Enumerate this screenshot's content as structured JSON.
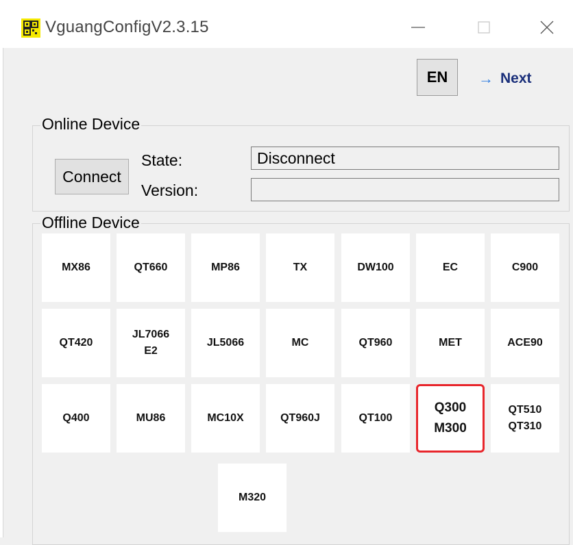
{
  "window": {
    "title": "VguangConfigV2.3.15"
  },
  "toolbar": {
    "language_label": "EN",
    "next_arrow": "→",
    "next_label": "Next"
  },
  "online_device": {
    "group_label": "Online Device",
    "connect_label": "Connect",
    "state_label": "State:",
    "state_value": "Disconnect",
    "version_label": "Version:",
    "version_value": ""
  },
  "offline_device": {
    "group_label": "Offline Device",
    "devices": [
      {
        "lines": [
          "MX86"
        ]
      },
      {
        "lines": [
          "QT660"
        ]
      },
      {
        "lines": [
          "MP86"
        ]
      },
      {
        "lines": [
          "TX"
        ]
      },
      {
        "lines": [
          "DW100"
        ]
      },
      {
        "lines": [
          "EC"
        ]
      },
      {
        "lines": [
          "C900"
        ]
      },
      {
        "lines": [
          "QT420"
        ]
      },
      {
        "lines": [
          "JL7066",
          "E2"
        ]
      },
      {
        "lines": [
          "JL5066"
        ]
      },
      {
        "lines": [
          "MC"
        ]
      },
      {
        "lines": [
          "QT960"
        ]
      },
      {
        "lines": [
          "MET"
        ]
      },
      {
        "lines": [
          "ACE90"
        ]
      },
      {
        "lines": [
          "Q400"
        ]
      },
      {
        "lines": [
          "MU86"
        ]
      },
      {
        "lines": [
          "MC10X"
        ]
      },
      {
        "lines": [
          "QT960J"
        ]
      },
      {
        "lines": [
          "QT100"
        ]
      },
      {
        "lines": [
          "Q300",
          "M300"
        ],
        "highlighted": true,
        "highlight_color": "#e8262c"
      },
      {
        "lines": [
          "QT510",
          "QT310"
        ]
      },
      {
        "lines": [
          "M320"
        ]
      }
    ]
  },
  "icons": {
    "app": "qr-code-icon",
    "minimize": "minimize-icon",
    "maximize": "maximize-icon",
    "close": "close-icon"
  }
}
